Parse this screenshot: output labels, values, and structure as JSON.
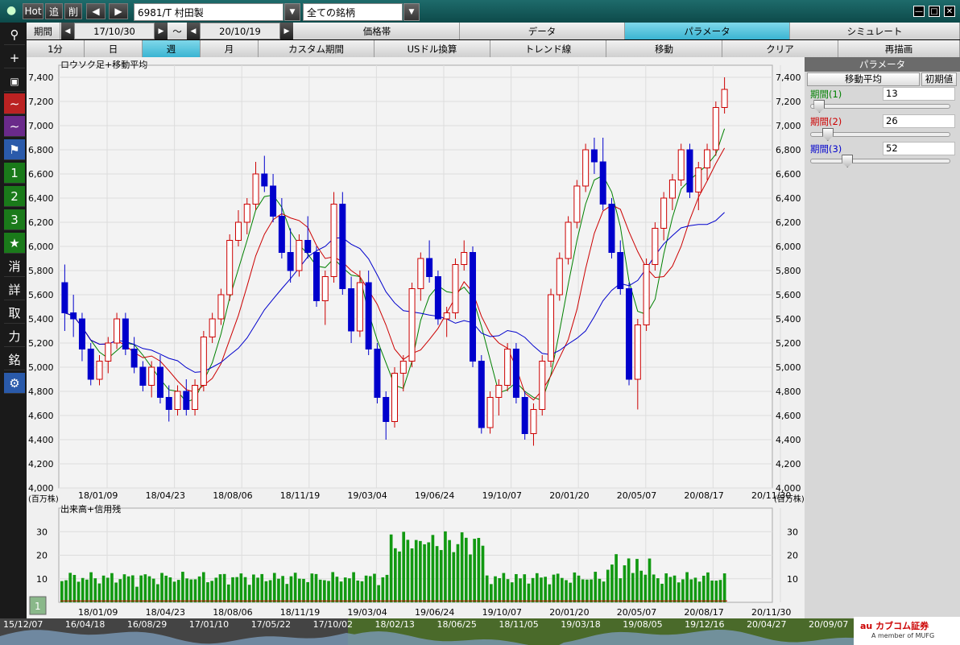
{
  "title_bar": {
    "hot_label": "Hot",
    "tsui_label": "追",
    "saku_label": "削",
    "prev_icon": "◀",
    "next_icon": "▶",
    "symbol": "6981/T 村田製",
    "list_name": "全ての銘柄"
  },
  "period_row": {
    "label": "期間",
    "start": "17/10/30",
    "tilde": "～",
    "end": "20/10/19",
    "tabs": [
      "価格帯",
      "データ",
      "パラメータ",
      "シミュレート"
    ]
  },
  "interval_row": {
    "items": [
      "1分",
      "日",
      "週",
      "月",
      "カスタム期間",
      "USドル換算",
      "トレンド線",
      "移動",
      "クリア",
      "再描画"
    ]
  },
  "left_toolbar": [
    "search-icon",
    "crosshair-icon",
    "camera-icon",
    "line-chart-icon",
    "line-chart-icon",
    "flag-icon",
    "1",
    "2",
    "3",
    "★",
    "消",
    "詳",
    "取",
    "力",
    "銘",
    "gear-icon"
  ],
  "right_panel": {
    "header": "パラメータ",
    "tab_active": "移動平均",
    "reset_label": "初期値",
    "params": [
      {
        "label": "期間(1)",
        "value": "13",
        "color": "#008000",
        "level": 0.06
      },
      {
        "label": "期間(2)",
        "value": "26",
        "color": "#cc0000",
        "level": 0.12
      },
      {
        "label": "期間(3)",
        "value": "52",
        "color": "#0000cc",
        "level": 0.26
      }
    ]
  },
  "main_chart": {
    "title": "ロウソク足+移動平均",
    "y_ticks": [
      "7,400",
      "7,200",
      "7,000",
      "6,800",
      "6,600",
      "6,400",
      "6,200",
      "6,000",
      "5,800",
      "5,600",
      "5,400",
      "5,200",
      "5,000",
      "4,800",
      "4,600",
      "4,400",
      "4,200",
      "4,000"
    ],
    "x_ticks": [
      "18/01/09",
      "18/04/23",
      "18/08/06",
      "18/11/19",
      "19/03/04",
      "19/06/24",
      "19/10/07",
      "20/01/20",
      "20/05/07",
      "20/08/17",
      "20/11/30"
    ]
  },
  "volume_chart": {
    "unit": "(百万株)",
    "title": "出来高+信用残",
    "y_ticks": [
      "30",
      "20",
      "10"
    ],
    "marker": "1"
  },
  "timeline": {
    "labels": [
      "15/12/07",
      "16/04/18",
      "16/08/29",
      "17/01/10",
      "17/05/22",
      "17/10/02",
      "18/02/13",
      "18/06/25",
      "18/11/05",
      "19/03/18",
      "19/08/05",
      "19/12/16",
      "20/04/27",
      "20/09/07"
    ]
  },
  "logo": {
    "brand": "au カブコム証券",
    "sub": "A member of MUFG"
  },
  "colors": {
    "up": "#cc0000",
    "down": "#0000cc",
    "ma1": "#008000",
    "ma2": "#cc0000",
    "ma3": "#0000cc",
    "volume": "#119911",
    "accent": "#3ab4d2"
  },
  "chart_data": {
    "type": "candlestick",
    "ylim": [
      4000,
      7500
    ],
    "x_start": "17/10/30",
    "x_end": "20/10/19",
    "ohlc_weekly_approx": [
      [
        5700,
        5850,
        5300,
        5450
      ],
      [
        5450,
        5600,
        5250,
        5400
      ],
      [
        5400,
        5450,
        5050,
        5150
      ],
      [
        5150,
        5200,
        4850,
        4900
      ],
      [
        4900,
        5100,
        4850,
        5050
      ],
      [
        5050,
        5250,
        4950,
        5200
      ],
      [
        5200,
        5450,
        5150,
        5400
      ],
      [
        5400,
        5450,
        5100,
        5150
      ],
      [
        5150,
        5250,
        4950,
        5000
      ],
      [
        5000,
        5050,
        4800,
        4850
      ],
      [
        4850,
        5050,
        4750,
        5000
      ],
      [
        5000,
        5100,
        4700,
        4750
      ],
      [
        4750,
        4850,
        4550,
        4650
      ],
      [
        4650,
        4850,
        4600,
        4800
      ],
      [
        4800,
        4900,
        4600,
        4650
      ],
      [
        4650,
        4900,
        4600,
        4850
      ],
      [
        4850,
        5300,
        4800,
        5250
      ],
      [
        5250,
        5450,
        5200,
        5400
      ],
      [
        5400,
        5650,
        5350,
        5600
      ],
      [
        5600,
        6100,
        5550,
        6050
      ],
      [
        6050,
        6300,
        6000,
        6200
      ],
      [
        6200,
        6400,
        6100,
        6350
      ],
      [
        6350,
        6700,
        6300,
        6600
      ],
      [
        6600,
        6750,
        6450,
        6500
      ],
      [
        6500,
        6600,
        6200,
        6250
      ],
      [
        6250,
        6400,
        5900,
        5950
      ],
      [
        5950,
        6150,
        5700,
        5800
      ],
      [
        5800,
        6100,
        5750,
        6050
      ],
      [
        6050,
        6250,
        5900,
        5950
      ],
      [
        5950,
        6000,
        5500,
        5550
      ],
      [
        5550,
        5800,
        5350,
        5750
      ],
      [
        5750,
        6450,
        5700,
        6350
      ],
      [
        6350,
        6450,
        5600,
        5650
      ],
      [
        5650,
        5750,
        5200,
        5300
      ],
      [
        5300,
        5800,
        5250,
        5700
      ],
      [
        5700,
        5800,
        5100,
        5150
      ],
      [
        5150,
        5200,
        4700,
        4750
      ],
      [
        4750,
        4800,
        4400,
        4550
      ],
      [
        4550,
        5000,
        4500,
        4950
      ],
      [
        4950,
        5100,
        4800,
        5050
      ],
      [
        5050,
        5700,
        5000,
        5650
      ],
      [
        5650,
        5950,
        5550,
        5900
      ],
      [
        5900,
        6050,
        5700,
        5750
      ],
      [
        5750,
        5800,
        5350,
        5400
      ],
      [
        5400,
        5500,
        5250,
        5450
      ],
      [
        5450,
        5900,
        5400,
        5850
      ],
      [
        5850,
        6050,
        5800,
        5950
      ],
      [
        5950,
        6000,
        5000,
        5050
      ],
      [
        5050,
        5100,
        4450,
        4500
      ],
      [
        4500,
        4800,
        4450,
        4750
      ],
      [
        4750,
        4900,
        4600,
        4850
      ],
      [
        4850,
        5200,
        4800,
        5150
      ],
      [
        5150,
        5200,
        4700,
        4750
      ],
      [
        4750,
        4800,
        4400,
        4450
      ],
      [
        4450,
        4700,
        4350,
        4650
      ],
      [
        4650,
        5100,
        4600,
        5050
      ],
      [
        5050,
        5650,
        5000,
        5600
      ],
      [
        5600,
        5950,
        5550,
        5900
      ],
      [
        5900,
        6250,
        5850,
        6200
      ],
      [
        6200,
        6550,
        6150,
        6500
      ],
      [
        6500,
        6850,
        6450,
        6800
      ],
      [
        6800,
        6900,
        6600,
        6700
      ],
      [
        6700,
        6900,
        6300,
        6350
      ],
      [
        6350,
        6400,
        5900,
        5950
      ],
      [
        5950,
        6050,
        5600,
        5650
      ],
      [
        5650,
        5700,
        4850,
        4900
      ],
      [
        4900,
        5400,
        4650,
        5350
      ],
      [
        5350,
        5900,
        5300,
        5850
      ],
      [
        5850,
        6200,
        5800,
        6150
      ],
      [
        6150,
        6450,
        6050,
        6400
      ],
      [
        6400,
        6600,
        6300,
        6550
      ],
      [
        6550,
        6850,
        6500,
        6800
      ],
      [
        6800,
        6850,
        6400,
        6450
      ],
      [
        6450,
        6700,
        6300,
        6650
      ],
      [
        6650,
        6850,
        6550,
        6800
      ],
      [
        6800,
        7200,
        6750,
        7150
      ],
      [
        7150,
        7400,
        7100,
        7300
      ]
    ],
    "ma_periods": [
      13,
      26,
      52
    ],
    "volume_unit": "百万株",
    "volume_ylim": [
      0,
      40
    ]
  }
}
